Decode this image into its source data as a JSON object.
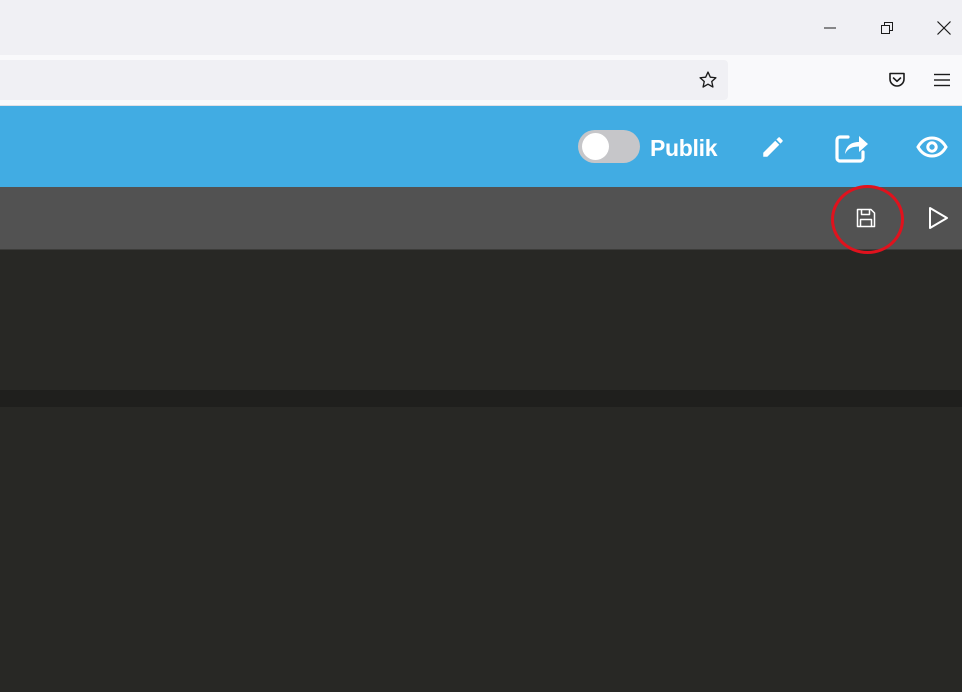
{
  "browser": {
    "window_controls": {
      "minimize_icon": "minimize-icon",
      "restore_icon": "restore-icon",
      "close_icon": "close-icon"
    },
    "toolbar": {
      "bookmark_icon": "star-icon",
      "pocket_icon": "pocket-icon",
      "menu_icon": "hamburger-menu-icon"
    }
  },
  "app": {
    "header": {
      "public_toggle": {
        "label": "Publik",
        "checked": false
      },
      "icons": [
        "pencil-icon",
        "share-icon",
        "eye-icon"
      ]
    },
    "editor_toolbar": {
      "icons": [
        "save-icon",
        "play-icon"
      ],
      "highlighted": "save-icon"
    }
  },
  "colors": {
    "app_header": "#41ace3",
    "editor_toolbar": "#525252",
    "editor_background": "#282825",
    "highlight_circle": "#e0121d"
  }
}
